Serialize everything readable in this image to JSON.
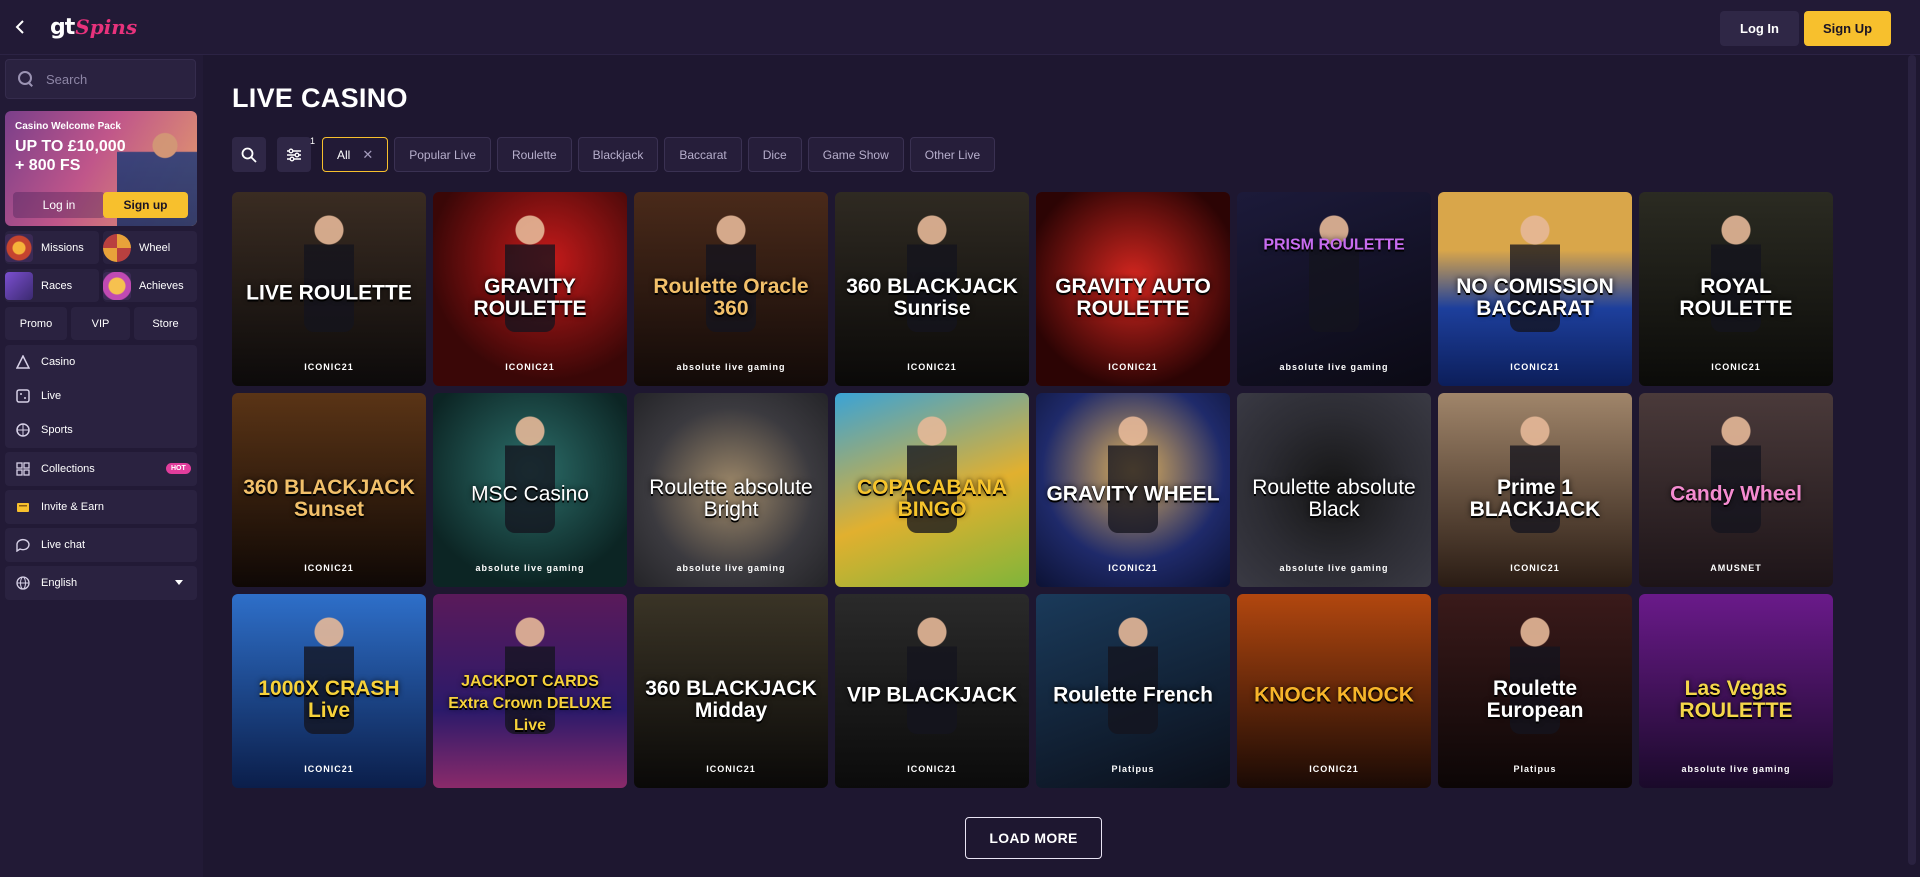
{
  "header": {
    "logo_main": "gt",
    "logo_accent": "Spins",
    "login_label": "Log In",
    "signup_label": "Sign Up"
  },
  "sidebar": {
    "search_placeholder": "Search",
    "promo": {
      "title": "Casino Welcome Pack",
      "offer": "UP TO £10,000 + 800 FS",
      "login_label": "Log in",
      "signup_label": "Sign up"
    },
    "quick": [
      {
        "label": "Missions",
        "icon": "missions-icon"
      },
      {
        "label": "Wheel",
        "icon": "wheel-icon"
      },
      {
        "label": "Races",
        "icon": "races-icon"
      },
      {
        "label": "Achieves",
        "icon": "achieves-icon"
      }
    ],
    "small_buttons": [
      "Promo",
      "VIP",
      "Store"
    ],
    "nav_main": [
      {
        "label": "Casino",
        "icon": "casino-icon"
      },
      {
        "label": "Live",
        "icon": "live-icon"
      },
      {
        "label": "Sports",
        "icon": "sports-icon"
      }
    ],
    "collections": {
      "label": "Collections",
      "badge": "HOT"
    },
    "invite": "Invite & Earn",
    "live_chat": "Live chat",
    "language": "English"
  },
  "main": {
    "title": "LIVE CASINO",
    "filter_badge": "1",
    "chips": [
      "All",
      "Popular Live",
      "Roulette",
      "Blackjack",
      "Baccarat",
      "Dice",
      "Game Show",
      "Other Live"
    ],
    "load_more": "LOAD MORE"
  },
  "games": [
    {
      "title": "LIVE ROULETTE",
      "provider": "ICONIC21"
    },
    {
      "title": "GRAVITY ROULETTE",
      "provider": "ICONIC21"
    },
    {
      "title": "Roulette Oracle 360",
      "provider": "absolute live gaming"
    },
    {
      "title": "360 BLACKJACK Sunrise",
      "provider": "ICONIC21"
    },
    {
      "title": "GRAVITY AUTO ROULETTE",
      "provider": "ICONIC21"
    },
    {
      "title": "PRISM ROULETTE",
      "provider": "absolute live gaming"
    },
    {
      "title": "NO COMISSION BACCARAT",
      "provider": "ICONIC21"
    },
    {
      "title": "ROYAL ROULETTE",
      "provider": "ICONIC21"
    },
    {
      "title": "360 BLACKJACK Sunset",
      "provider": "ICONIC21"
    },
    {
      "title": "MSC Casino",
      "provider": "absolute live gaming"
    },
    {
      "title": "Roulette absolute Bright",
      "provider": "absolute live gaming"
    },
    {
      "title": "COPACABANA BINGO",
      "provider": ""
    },
    {
      "title": "GRAVITY WHEEL",
      "provider": "ICONIC21"
    },
    {
      "title": "Roulette absolute Black",
      "provider": "absolute live gaming"
    },
    {
      "title": "Prime 1 BLACKJACK",
      "provider": "ICONIC21"
    },
    {
      "title": "Candy Wheel",
      "provider": "AMUSNET"
    },
    {
      "title": "1000X CRASH Live",
      "provider": "ICONIC21"
    },
    {
      "title": "JACKPOT CARDS Extra Crown DELUXE Live",
      "provider": ""
    },
    {
      "title": "360 BLACKJACK Midday",
      "provider": "ICONIC21"
    },
    {
      "title": "VIP BLACKJACK",
      "provider": "ICONIC21"
    },
    {
      "title": "Roulette French",
      "provider": "Platipus"
    },
    {
      "title": "KNOCK KNOCK",
      "provider": "ICONIC21"
    },
    {
      "title": "Roulette European",
      "provider": "Platipus"
    },
    {
      "title": "Las Vegas ROULETTE",
      "provider": "absolute live gaming"
    }
  ],
  "colors": {
    "accent": "#f7c02d",
    "background": "#1e1730",
    "panel": "#221a36",
    "hot_badge": "#e13d9c"
  }
}
